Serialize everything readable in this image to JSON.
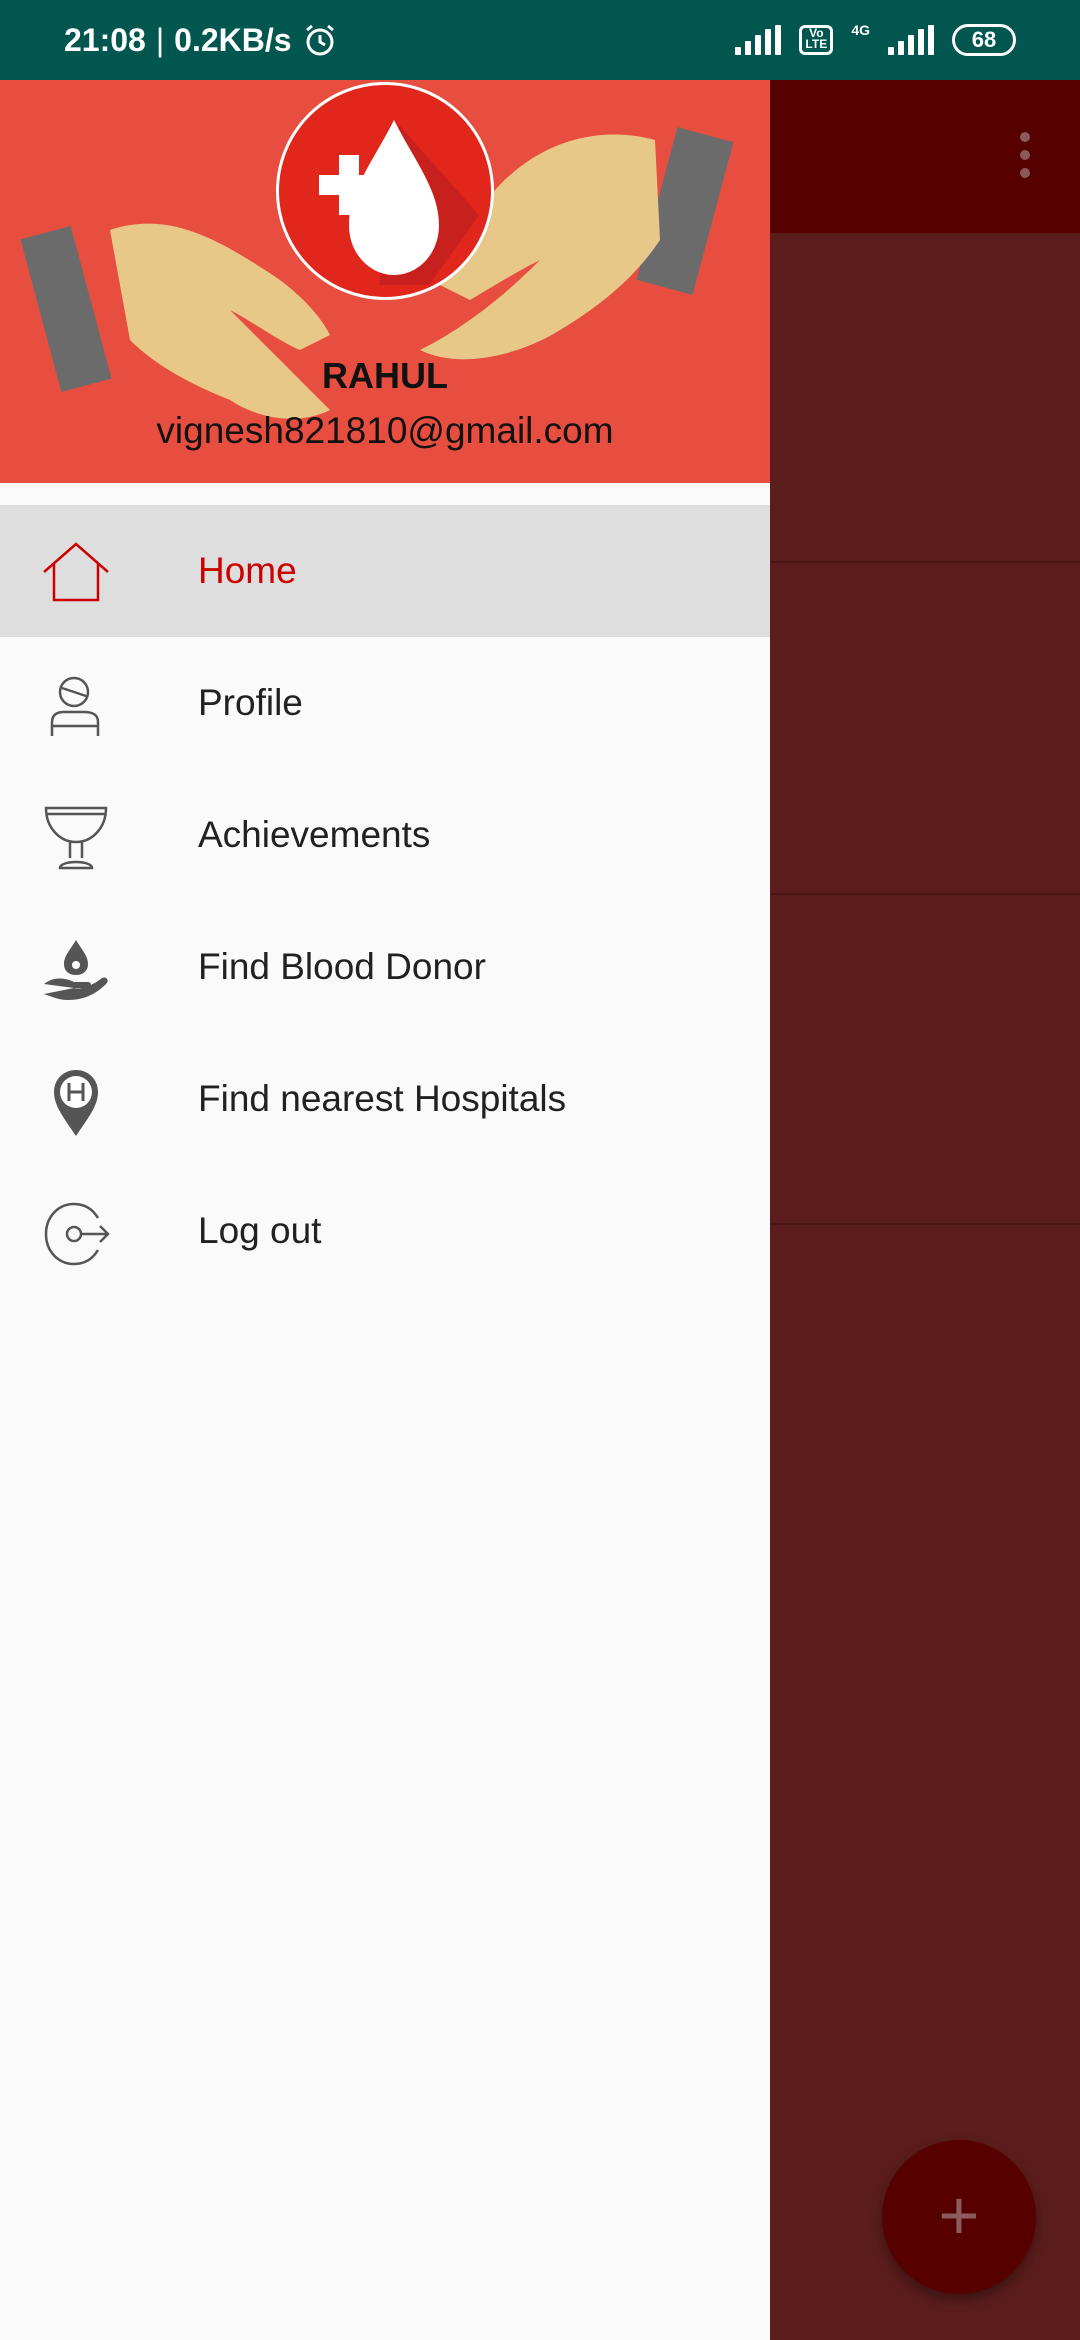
{
  "status_bar": {
    "time": "21:08",
    "separator": "|",
    "speed": "0.2KB/s",
    "network_label": "4G",
    "volte_label": "Vo LTE",
    "battery": "68"
  },
  "drawer": {
    "user_name": "RAHUL",
    "user_email": "vignesh821810@gmail.com",
    "items": [
      {
        "label": "Home",
        "icon": "home-icon",
        "active": true
      },
      {
        "label": "Profile",
        "icon": "profile-icon"
      },
      {
        "label": "Achievements",
        "icon": "trophy-icon"
      },
      {
        "label": "Find Blood Donor",
        "icon": "blood-donor-icon"
      },
      {
        "label": "Find nearest Hospitals",
        "icon": "hospital-pin-icon"
      },
      {
        "label": "Log out",
        "icon": "logout-icon"
      }
    ]
  },
  "background": {
    "fab_label": "+",
    "colors": {
      "toolbar": "#560000",
      "content": "#5b1d1b"
    }
  },
  "colors": {
    "status_bar": "#01574f",
    "header": "#e84e40",
    "active_text": "#cc0000",
    "active_bg": "#dedede"
  }
}
